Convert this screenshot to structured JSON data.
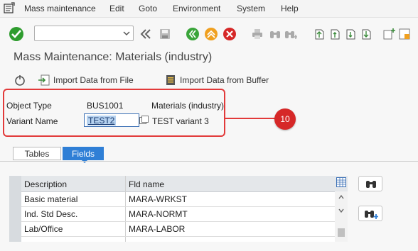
{
  "menubar": {
    "items": [
      "Mass maintenance",
      "Edit",
      "Goto",
      "Environment",
      "System",
      "Help"
    ]
  },
  "toolbar": {
    "command_field_value": "",
    "icons": [
      "enter-icon",
      "back-arrows-icon",
      "save-icon",
      "back-icon",
      "exit-icon",
      "cancel-icon",
      "print-icon",
      "find-icon",
      "find-next-icon",
      "first-page-icon",
      "previous-page-icon",
      "next-page-icon",
      "last-page-icon",
      "create-session-icon"
    ]
  },
  "title": "Mass Maintenance: Materials (industry)",
  "app_toolbar": {
    "execute_icon": "execute-icon",
    "import_file": "Import Data from File",
    "import_buffer": "Import Data from Buffer"
  },
  "header_fields": {
    "object_type_label": "Object Type",
    "object_type_value": "BUS1001",
    "object_type_desc": "Materials (industry)",
    "variant_label": "Variant Name",
    "variant_value": "TEST2",
    "variant_desc": "TEST variant 3"
  },
  "callout_number": "10",
  "tabs": [
    "Tables",
    "Fields"
  ],
  "active_tab": "Fields",
  "table": {
    "columns": [
      "Description",
      "Fld name"
    ],
    "rows": [
      {
        "description": "Basic material",
        "fld_name": "MARA-WRKST"
      },
      {
        "description": "Ind. Std Desc.",
        "fld_name": "MARA-NORMT"
      },
      {
        "description": "Lab/Office",
        "fld_name": "MARA-LABOR"
      }
    ]
  },
  "colors": {
    "accent": "#2f7fd6",
    "callout_red": "#d62828",
    "ok_green": "#2e9c2e"
  }
}
